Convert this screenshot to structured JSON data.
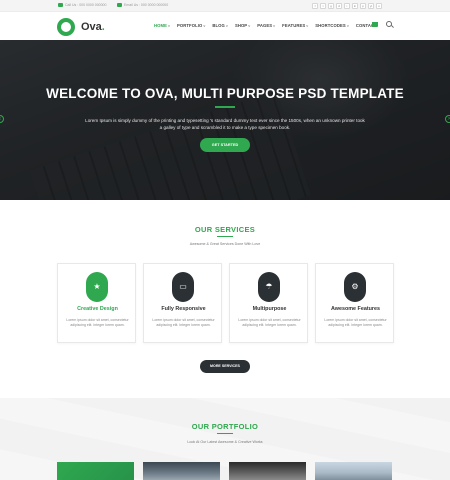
{
  "topbar": {
    "phone": "Call Us : 000 0000 000000",
    "email": "Email Us : 000 0000 000000",
    "social_icons": [
      "facebook-icon",
      "twitter-icon",
      "google-plus-icon",
      "dribbble-icon",
      "instagram-icon",
      "linkedin-icon",
      "pinterest-icon",
      "youtube-icon",
      "skype-icon"
    ],
    "social_glyphs": [
      "f",
      "t",
      "g",
      "d",
      "i",
      "in",
      "p",
      "yt",
      "s"
    ]
  },
  "header": {
    "logo_text": "Ova",
    "logo_dot": ".",
    "nav": [
      {
        "label": "HOME",
        "active": true
      },
      {
        "label": "PORTFOLIO"
      },
      {
        "label": "BLOG"
      },
      {
        "label": "SHOP"
      },
      {
        "label": "PAGES"
      },
      {
        "label": "FEATURES"
      },
      {
        "label": "SHORTCODES"
      },
      {
        "label": "CONTACT"
      }
    ],
    "caret": "v"
  },
  "hero": {
    "title": "WELCOME TO OVA, MULTI PURPOSE PSD TEMPLATE",
    "text": "Lorem Ipsum is simply dummy of the printing and typesetting 's standard dummy text ever since the 1500s, when an unknown printer took a galley of type and scrambled it to make a type specimen book.",
    "button": "GET STARTED",
    "prev": "<",
    "next": ">"
  },
  "services": {
    "title": "OUR SERVICES",
    "subtitle": "Awesome & Great Services Done With Love",
    "cards": [
      {
        "title": "Creative Design",
        "icon": "star-icon",
        "glyph": "★",
        "text": "Lorem ipsum dolor sit amet, consectetur adipiscing elit. Integer lorem quam.",
        "highlight": true
      },
      {
        "title": "Fully Responsive",
        "icon": "monitor-icon",
        "glyph": "▭",
        "text": "Lorem ipsum dolor sit amet, consectetur adipiscing elit. Integer lorem quam."
      },
      {
        "title": "Multipurpose",
        "icon": "umbrella-icon",
        "glyph": "☂",
        "text": "Lorem ipsum dolor sit amet, consectetur adipiscing elit. Integer lorem quam."
      },
      {
        "title": "Awesome Features",
        "icon": "gear-icon",
        "glyph": "⚙",
        "text": "Lorem ipsum dolor sit amet, consectetur adipiscing elit. Integer lorem quam."
      }
    ],
    "more_button": "MORE SERVICES"
  },
  "portfolio": {
    "title": "OUR PORTFOLIO",
    "subtitle": "Look At Our Latest Awesome & Creative Works"
  },
  "colors": {
    "accent": "#2fa84f",
    "dark": "#2b3035"
  }
}
